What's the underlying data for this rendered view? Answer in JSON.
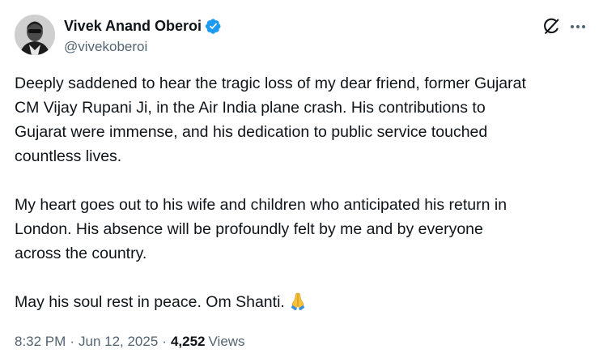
{
  "author": {
    "name": "Vivek Anand Oberoi",
    "handle": "@vivekoberoi",
    "verified": true
  },
  "header_icons": [
    "grok-icon",
    "more-options-icon"
  ],
  "tweet": {
    "paragraphs": [
      {
        "lines": [
          "Deeply saddened to hear the tragic loss of my dear friend, former Gujarat",
          "CM Vijay Rupani Ji, in the Air India plane crash. His contributions to",
          "Gujarat were immense, and his dedication to public service touched",
          "countless lives."
        ]
      },
      {
        "lines": [
          "My heart goes out to his wife and children who anticipated his return in",
          "London. His absence will be profoundly felt by me and by everyone",
          "across the country."
        ]
      },
      {
        "lines": [
          "May his soul rest in peace. Om Shanti."
        ],
        "emoji": "folded-hands"
      }
    ]
  },
  "meta": {
    "time": "8:32 PM",
    "separator": "·",
    "date": "Jun 12, 2025",
    "views_count": "4,252",
    "views_label": "Views"
  },
  "colors": {
    "text": "#0f1419",
    "secondary": "#536471",
    "verified_blue": "#1d9bf0"
  }
}
